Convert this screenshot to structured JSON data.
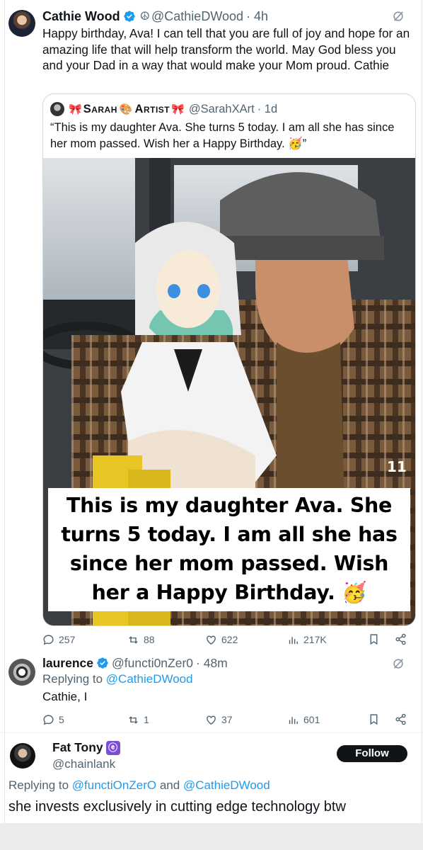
{
  "main_tweet": {
    "author": "Cathie Wood",
    "handle": "@CathieDWood",
    "time": "· 4h",
    "text": "Happy birthday, Ava! I can tell that you are full of joy and hope for an amazing life that will help transform the world. May God bless you and your Dad in a way that would make your Mom proud. Cathie"
  },
  "quoted_tweet": {
    "name_part1": "Sarah",
    "name_part2": "Artist",
    "handle": "@SarahXArt",
    "time": "· 1d",
    "text": "“This is my daughter Ava. She turns 5 today. I am all she has since her mom passed. Wish her a Happy Birthday. 🥳”",
    "image_caption": "This is my daughter Ava. She turns 5 today. I am all she has since her mom passed. Wish her a Happy Birthday. 🥳",
    "image_page": "11"
  },
  "main_actions": {
    "replies": "257",
    "reposts": "88",
    "likes": "622",
    "views": "217K"
  },
  "reply1": {
    "author": "laurence",
    "handle": "@functi0nZer0",
    "time": "· 48m",
    "replying_prefix": "Replying to",
    "replying_to": "@CathieDWood",
    "text": "Cathie, I",
    "actions": {
      "replies": "5",
      "reposts": "1",
      "likes": "37",
      "views": "601"
    }
  },
  "reply2": {
    "author": "Fat Tony",
    "affiliate_badge": "ⓔ",
    "handle": "@chainlank",
    "follow_label": "Follow",
    "replying_prefix": "Replying to",
    "replying_to_1": "@functiOnZerO",
    "replying_and": "and",
    "replying_to_2": "@CathieDWood",
    "text": "she invests exclusively in cutting edge technology btw"
  },
  "colors": {
    "accent": "#1d9bf0",
    "text": "#0f1419",
    "muted": "#536471",
    "border": "#cfd9de"
  },
  "icons": [
    "verified-badge-icon",
    "peace-icon",
    "grok-icon",
    "reply-icon",
    "repost-icon",
    "like-icon",
    "views-icon",
    "bookmark-icon",
    "share-icon"
  ]
}
